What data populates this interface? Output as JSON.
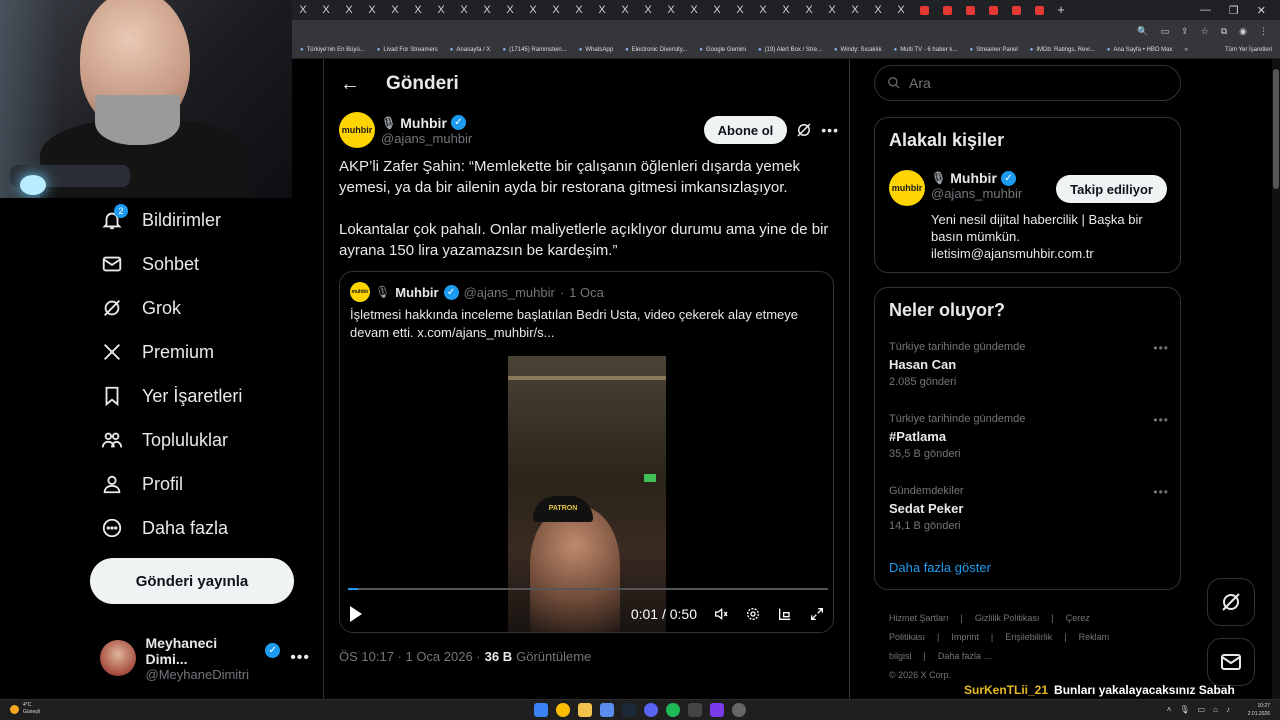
{
  "browser": {
    "tab_glyph": "X",
    "tabs_count": 33,
    "new_tab": "+",
    "window_controls": [
      "—",
      "❐",
      "✕"
    ],
    "bookmarks": [
      "Türkiye'nin En Büyü...",
      "Livad For Streamers",
      "Anasayfa / X",
      "(17145) Rammstein...",
      "WhatsApp",
      "Electronic Diversity...",
      "Google Gemini",
      "(19) Alert Box / Stre...",
      "Windy: Sıcaklık",
      "Multi TV - 6 haber k...",
      "Streamer Panel",
      "IMDb: Ratings, Revi...",
      "Ana Sayfa • HBO Max"
    ],
    "bookmarks_more": "»",
    "bookmarks_all": "Tüm Yer İşaretleri"
  },
  "nav": {
    "items": [
      {
        "label": "Bildirimler",
        "icon": "bell-icon",
        "badge": "2"
      },
      {
        "label": "Sohbet",
        "icon": "mail-icon"
      },
      {
        "label": "Grok",
        "icon": "grok-icon"
      },
      {
        "label": "Premium",
        "icon": "x-logo-icon"
      },
      {
        "label": "Yer İşaretleri",
        "icon": "bookmark-icon"
      },
      {
        "label": "Topluluklar",
        "icon": "people-icon"
      },
      {
        "label": "Profil",
        "icon": "person-icon"
      },
      {
        "label": "Daha fazla",
        "icon": "more-circle-icon"
      }
    ],
    "post_button": "Gönderi yayınla",
    "account": {
      "name": "Meyhaneci Dimi...",
      "handle": "@MeyhaneDimitri",
      "more": "•••"
    }
  },
  "main": {
    "back": "←",
    "title": "Gönderi",
    "author": {
      "name": "Muhbir",
      "handle": "@ajans_muhbir",
      "logo": "muhbir"
    },
    "follow_button": "Abone ol",
    "more": "•••",
    "text_1": "AKP’li Zafer Şahin: “Memlekette bir çalışanın öğlenleri dışarda yemek yemesi, ya da bir ailenin ayda bir restorana gitmesi imkansızlaşıyor.",
    "text_2": "Lokantalar çok pahalı. Onlar maliyetlerle açıklıyor durumu ama yine de bir ayrana 150 lira yazamazsın be kardeşim.”",
    "quote": {
      "name": "Muhbir",
      "handle": "@ajans_muhbir",
      "sep": "·",
      "date": "1 Oca",
      "text": "İşletmesi hakkında inceleme başlatılan Bedri Usta, video çekerek alay etmeye devam etti.  x.com/ajans_muhbir/s...",
      "cap_text": "PATRON",
      "video_time": "0:01 / 0:50",
      "progress": 0.02
    },
    "meta": {
      "time": "ÖS 10:17 · 1 Oca 2026 ·",
      "views_count": "36 B",
      "views_label": "Görüntüleme"
    }
  },
  "right": {
    "search_placeholder": "Ara",
    "related": {
      "title": "Alakalı kişiler",
      "name": "Muhbir",
      "handle": "@ajans_muhbir",
      "follow": "Takip ediliyor",
      "bio": "Yeni nesil dijital habercilik | Başka bir basın mümkün. iletisim@ajansmuhbir.com.tr"
    },
    "trends": {
      "title": "Neler oluyor?",
      "items": [
        {
          "context": "Türkiye tarihinde gündemde",
          "name": "Hasan Can",
          "count": "2.085 gönderi"
        },
        {
          "context": "Türkiye tarihinde gündemde",
          "name": "#Patlama",
          "count": "35,5 B gönderi"
        },
        {
          "context": "Gündemdekiler",
          "name": "Sedat Peker",
          "count": "14,1 B gönderi"
        }
      ],
      "show_more": "Daha fazla göster"
    },
    "footer": {
      "links": [
        "Hizmet Şartları",
        "|",
        "Gizlilik Politikası",
        "|",
        "Çerez Politikası",
        "|",
        "Imprint",
        "|",
        "Erişilebilirlik",
        "|",
        "Reklam bilgisi",
        "|",
        "Daha fazla …"
      ],
      "copyright": "© 2026 X Corp."
    }
  },
  "chat": {
    "user": "SurKenTLii_21",
    "message": "Bunları yakalayacaksınız Sabah akşam köpek maması vereceksin"
  },
  "taskbar": {
    "weather_temp": "4°C",
    "weather_desc": "Güneşli",
    "clock_time": "10:27",
    "clock_date": "2.01.2026"
  }
}
